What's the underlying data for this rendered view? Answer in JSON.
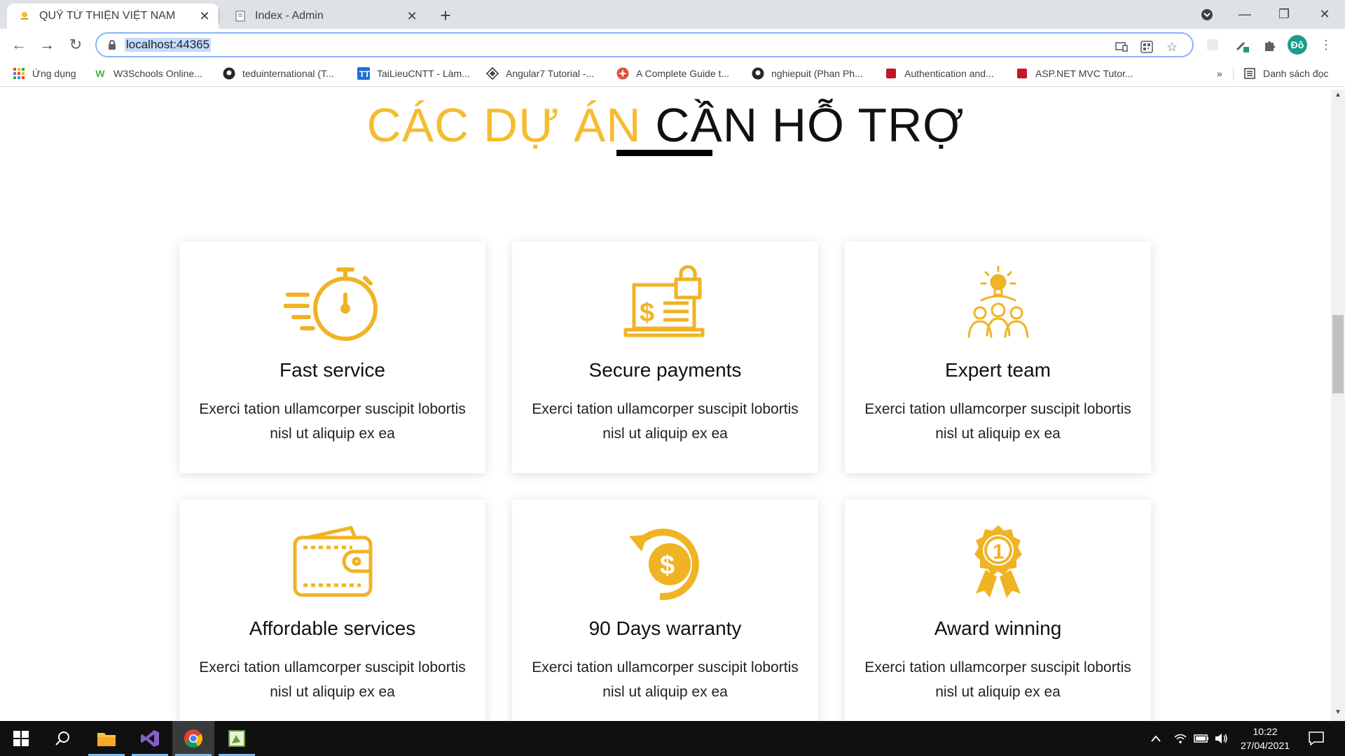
{
  "browser": {
    "tabs": [
      {
        "title": "QUỸ TỪ THIỆN VIỆT NAM",
        "active": true
      },
      {
        "title": "Index - Admin",
        "active": false
      }
    ],
    "url": "localhost:44365",
    "profile_initial": "Đô",
    "bookmarks": [
      {
        "label": "Ứng dụng",
        "icon": "apps-grid-icon"
      },
      {
        "label": "W3Schools Online...",
        "icon": "w3schools-icon"
      },
      {
        "label": "teduinternational (T...",
        "icon": "github-icon"
      },
      {
        "label": "TaiLieuCNTT - Làm...",
        "icon": "tailieucntt-icon"
      },
      {
        "label": "Angular7 Tutorial -...",
        "icon": "angular-icon"
      },
      {
        "label": "A Complete Guide t...",
        "icon": "guide-icon"
      },
      {
        "label": "nghiepuit (Phan Ph...",
        "icon": "github-icon"
      },
      {
        "label": "Authentication and...",
        "icon": "bookmark-red-icon"
      },
      {
        "label": "ASP.NET MVC Tutor...",
        "icon": "bookmark-red-icon"
      }
    ],
    "bookmarks_overflow": "»",
    "reading_list": "Danh sách đọc"
  },
  "page": {
    "heading_part1": "CÁC DỰ ÁN",
    "heading_part2": "CẦN HỖ TRỢ",
    "cards": [
      {
        "title": "Fast service",
        "desc": "Exerci tation ullamcorper suscipit lobortis nisl ut aliquip ex ea",
        "icon": "stopwatch-icon"
      },
      {
        "title": "Secure payments",
        "desc": "Exerci tation ullamcorper suscipit lobortis nisl ut aliquip ex ea",
        "icon": "secure-laptop-icon"
      },
      {
        "title": "Expert team",
        "desc": "Exerci tation ullamcorper suscipit lobortis nisl ut aliquip ex ea",
        "icon": "team-idea-icon"
      },
      {
        "title": "Affordable services",
        "desc": "Exerci tation ullamcorper suscipit lobortis nisl ut aliquip ex ea",
        "icon": "wallet-icon"
      },
      {
        "title": "90 Days warranty",
        "desc": "Exerci tation ullamcorper suscipit lobortis nisl ut aliquip ex ea",
        "icon": "money-back-icon"
      },
      {
        "title": "Award winning",
        "desc": "Exerci tation ullamcorper suscipit lobortis nisl ut aliquip ex ea",
        "icon": "award-badge-icon"
      }
    ],
    "accent_color": "#f5bc2e"
  },
  "taskbar": {
    "time": "10:22",
    "date": "27/04/2021"
  }
}
